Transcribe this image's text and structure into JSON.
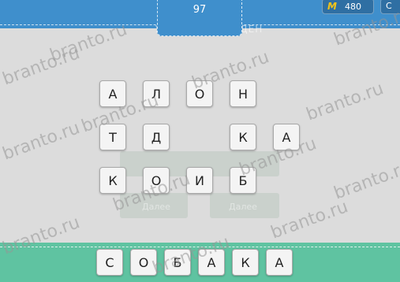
{
  "header": {
    "level": "97",
    "coins": "480",
    "coin_icon": "coin-icon",
    "caption": "УРОВЕНЬ ПРОЙДЕН"
  },
  "grid": {
    "tiles": [
      {
        "letter": "А"
      },
      {
        "letter": "Л"
      },
      {
        "letter": "О"
      },
      {
        "letter": "Н"
      },
      {
        "letter": "Т"
      },
      {
        "letter": "Д"
      },
      {
        "letter": "К"
      },
      {
        "letter": "А"
      },
      {
        "letter": "К"
      },
      {
        "letter": "О"
      },
      {
        "letter": "И"
      },
      {
        "letter": "Б"
      }
    ],
    "ghost_labels": [
      "Далее",
      "Далее"
    ]
  },
  "answer": {
    "slots": [
      {
        "letter": "С"
      },
      {
        "letter": "О"
      },
      {
        "letter": "Б"
      },
      {
        "letter": "А"
      },
      {
        "letter": "К"
      },
      {
        "letter": "А"
      }
    ]
  },
  "watermark": "branto.ru",
  "colors": {
    "top_bar": "#3f8fcc",
    "bottom_bar": "#5fc3a1",
    "background": "#dcdcdc",
    "coin": "#f5c518"
  }
}
